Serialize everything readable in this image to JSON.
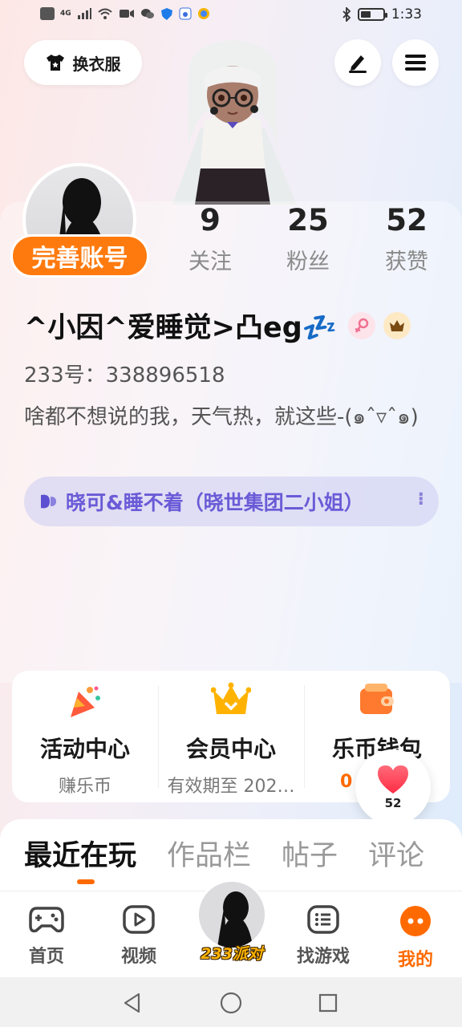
{
  "status_bar": {
    "time": "1:33",
    "net": "4G",
    "battery_level": 0.45
  },
  "header": {
    "outfit_label": "换衣服",
    "edit_icon": "pen-icon",
    "menu_icon": "hamburger-icon"
  },
  "profile": {
    "complete_label": "完善账号",
    "stats": [
      {
        "value": "9",
        "label": "关注"
      },
      {
        "value": "25",
        "label": "粉丝"
      },
      {
        "value": "52",
        "label": "获赞"
      }
    ],
    "nickname": "^小因^爱睡觉>凸eg💤",
    "gender_icon": "female-icon",
    "vip_icon": "crown-icon",
    "id_line": "233号：338896518",
    "bio": "啥都不想说的我，天气热，就这些-(๑ˆ▿ˆ๑)",
    "group": {
      "text": "晓可&睡不着（晓世集团二小姐）",
      "more": "⁝"
    }
  },
  "services": [
    {
      "title": "活动中心",
      "sub": "赚乐币",
      "icon": "party-popper-icon"
    },
    {
      "title": "会员中心",
      "sub": "有效期至 202…",
      "icon": "crown-icon"
    },
    {
      "title": "乐币钱包",
      "sub": "0",
      "icon": "wallet-icon"
    }
  ],
  "like_float": {
    "count": "52"
  },
  "tabs": [
    "最近在玩",
    "作品栏",
    "帖子",
    "评论"
  ],
  "bottom_nav": [
    {
      "label": "首页",
      "icon": "gamepad-icon"
    },
    {
      "label": "视频",
      "icon": "play-icon"
    },
    {
      "label": "233派对",
      "icon": "avatar"
    },
    {
      "label": "找游戏",
      "icon": "list-icon"
    },
    {
      "label": "我的",
      "icon": "face-icon"
    }
  ],
  "colors": {
    "accent": "#ff6a00",
    "badge": "#ff7a0e",
    "group_text": "#6a5bd7"
  }
}
